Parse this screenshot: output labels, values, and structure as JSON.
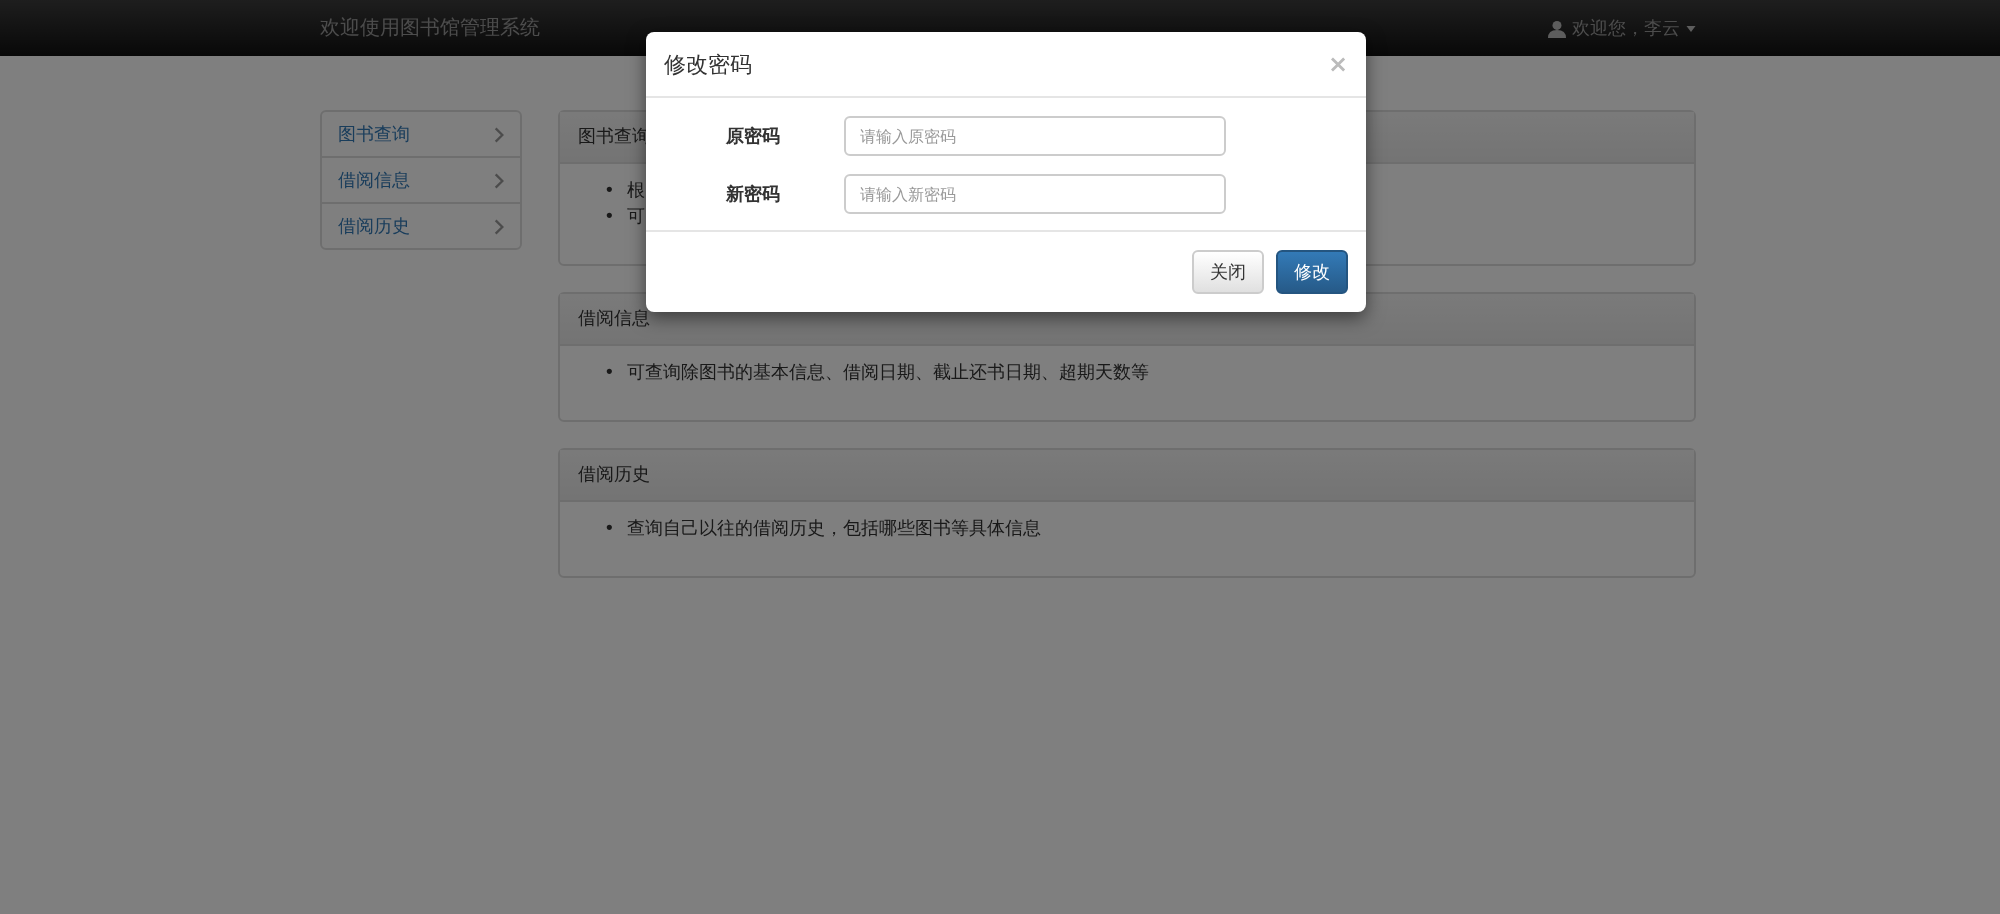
{
  "navbar": {
    "brand": "欢迎使用图书馆管理系统",
    "user_greeting": "欢迎您，李云"
  },
  "sidebar": {
    "items": [
      {
        "label": "图书查询"
      },
      {
        "label": "借阅信息"
      },
      {
        "label": "借阅历史"
      }
    ]
  },
  "panels": [
    {
      "title": "图书查询",
      "items": [
        {
          "marker": "•",
          "text": "根"
        },
        {
          "marker": "•",
          "text": "可"
        }
      ]
    },
    {
      "title": "借阅信息",
      "items": [
        {
          "marker": "•",
          "text": "可查询除图书的基本信息、借阅日期、截止还书日期、超期天数等"
        }
      ]
    },
    {
      "title": "借阅历史",
      "items": [
        {
          "marker": "•",
          "text": "查询自己以往的借阅历史，包括哪些图书等具体信息"
        }
      ]
    }
  ],
  "modal": {
    "title": "修改密码",
    "close_symbol": "×",
    "fields": [
      {
        "label": "原密码",
        "placeholder": "请输入原密码"
      },
      {
        "label": "新密码",
        "placeholder": "请输入新密码"
      }
    ],
    "buttons": [
      {
        "label": "关闭",
        "kind": "default"
      },
      {
        "label": "修改",
        "kind": "primary"
      }
    ]
  }
}
